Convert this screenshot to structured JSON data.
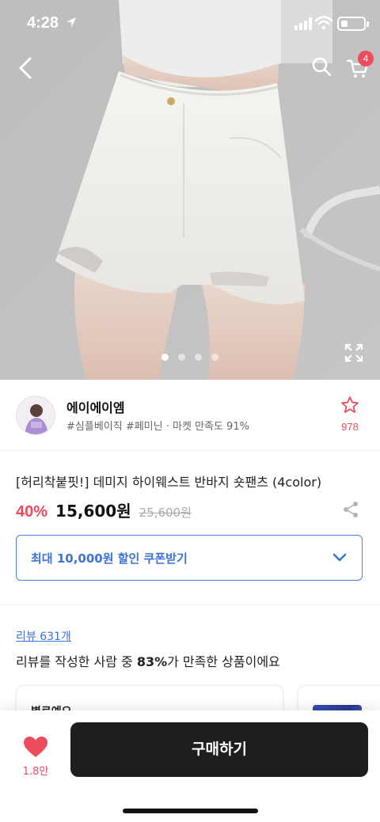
{
  "status_bar": {
    "time": "4:28"
  },
  "header": {
    "cart_count": "4",
    "icons": {
      "back": "back-arrow-icon",
      "search": "search-icon",
      "cart": "cart-icon",
      "expand": "expand-icon"
    }
  },
  "gallery": {
    "total_images": 4,
    "active_index": 0
  },
  "seller": {
    "name": "에이에이엠",
    "tags": "#심플베이직 #페미닌 · 마켓 만족도 91%",
    "favorite_count": "978"
  },
  "product": {
    "title": "[허리착붙핏!] 데미지 하이웨스트 반바지 숏팬츠 (4color)",
    "discount": "40%",
    "price": "15,600원",
    "original_price": "25,600원"
  },
  "coupon": {
    "label": "최대 10,000원 할인 쿠폰받기"
  },
  "reviews": {
    "link_text": "리뷰 631개",
    "summary_prefix": "리뷰를 작성한 사람 중 ",
    "summary_percent": "83%",
    "summary_suffix": "가 만족한 상품이에요",
    "card1_text": "별로예요"
  },
  "bottom": {
    "like_count": "1.8만",
    "buy_label": "구매하기"
  },
  "colors": {
    "accent_red": "#ec4c5c",
    "link_blue": "#3d72db",
    "buy_button": "#1e1e1e"
  }
}
